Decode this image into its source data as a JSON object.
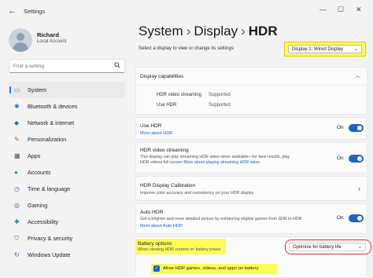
{
  "window": {
    "back_icon": "back-arrow-icon",
    "title": "Settings",
    "minimize": "—",
    "maximize": "☐",
    "close": "✕"
  },
  "user": {
    "name": "Richard",
    "account": "Local Account"
  },
  "search": {
    "placeholder": "Find a setting"
  },
  "sidebar": {
    "items": [
      {
        "label": "System",
        "icon": "monitor-icon",
        "active": true
      },
      {
        "label": "Bluetooth & devices",
        "icon": "bluetooth-icon"
      },
      {
        "label": "Network & internet",
        "icon": "wifi-icon"
      },
      {
        "label": "Personalization",
        "icon": "brush-icon"
      },
      {
        "label": "Apps",
        "icon": "apps-icon"
      },
      {
        "label": "Accounts",
        "icon": "person-icon"
      },
      {
        "label": "Time & language",
        "icon": "clock-icon"
      },
      {
        "label": "Gaming",
        "icon": "gamepad-icon"
      },
      {
        "label": "Accessibility",
        "icon": "accessibility-icon"
      },
      {
        "label": "Privacy & security",
        "icon": "shield-icon"
      },
      {
        "label": "Windows Update",
        "icon": "update-icon"
      }
    ]
  },
  "breadcrumb": {
    "part1": "System",
    "part2": "Display",
    "current": "HDR",
    "separator": "›"
  },
  "display": {
    "prompt": "Select a display to view or change its settings",
    "selected": "Display 1: Wired Display"
  },
  "capabilities": {
    "title": "Display capabilities",
    "rows": [
      {
        "name": "HDR video streaming",
        "value": "Supported"
      },
      {
        "name": "Use HDR",
        "value": "Supported"
      }
    ]
  },
  "use_hdr": {
    "title": "Use HDR",
    "link": "More about HDR",
    "state": "On"
  },
  "hdr_streaming": {
    "title": "HDR video streaming",
    "desc1": "This display can play streaming HDR video when available—for best results, play",
    "desc2": "HDR videos full screen",
    "link": "More about playing streaming HDR video",
    "state": "On"
  },
  "calibration": {
    "title": "HDR Display Calibration",
    "desc": "Improve color accuracy and consistency on your HDR display"
  },
  "auto_hdr": {
    "title": "Auto HDR",
    "desc": "Get a brighter and more detailed picture by enhancing eligible games from SDR to HDR",
    "link": "More about Auto HDR",
    "state": "On"
  },
  "battery": {
    "title": "Battery options",
    "desc": "When viewing HDR content on battery power",
    "selected": "Optimize for battery life"
  },
  "allow_games": {
    "label": "Allow HDR games, videos, and apps on battery",
    "checked": true
  },
  "colors": {
    "accent": "#1e63c6",
    "highlight": "#fffb57",
    "annotation_red": "#e02b2b"
  }
}
